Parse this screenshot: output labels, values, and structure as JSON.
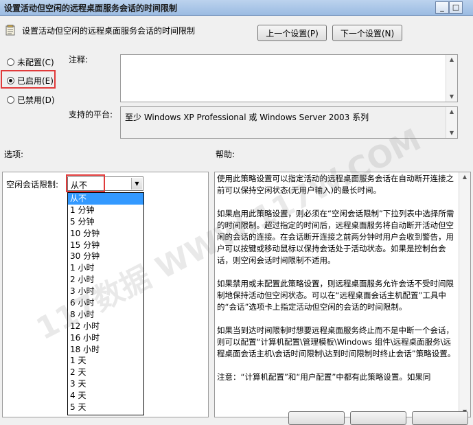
{
  "window": {
    "title": "设置活动但空闲的远程桌面服务会话的时间限制",
    "min_glyph": "_",
    "max_glyph": "□"
  },
  "header": {
    "title": "设置活动但空闲的远程桌面服务会话的时间限制",
    "prev_button": "上一个设置(P)",
    "next_button": "下一个设置(N)"
  },
  "state": {
    "not_configured": "未配置(C)",
    "enabled": "已启用(E)",
    "disabled": "已禁用(D)",
    "selected": "enabled"
  },
  "comment": {
    "label": "注释:",
    "value": ""
  },
  "platform": {
    "label": "支持的平台:",
    "value": "至少 Windows XP Professional 或 Windows Server 2003 系列"
  },
  "sections": {
    "options": "选项:",
    "help": "帮助:"
  },
  "options": {
    "idle_limit_label": "空闲会话限制:",
    "selected_value": "从不",
    "dropdown_items": [
      "从不",
      "1 分钟",
      "5 分钟",
      "10 分钟",
      "15 分钟",
      "30 分钟",
      "1 小时",
      "2 小时",
      "3 小时",
      "6 小时",
      "8 小时",
      "12 小时",
      "16 小时",
      "18 小时",
      "1 天",
      "2 天",
      "3 天",
      "4 天",
      "5 天"
    ]
  },
  "help": {
    "paragraphs": [
      "使用此策略设置可以指定活动的远程桌面服务会话在自动断开连接之前可以保持空闲状态(无用户输入)的最长时间。",
      "如果启用此策略设置，则必须在“空闲会话限制”下拉列表中选择所需的时间限制。超过指定的时间后，远程桌面服务将自动断开活动但空闲的会话的连接。在会话断开连接之前两分钟时用户会收到警告，用户可以按键或移动鼠标以保持会话处于活动状态。如果是控制台会话，则空闲会话时间限制不适用。",
      "如果禁用或未配置此策略设置，则远程桌面服务允许会话不受时间限制地保持活动但空闲状态。可以在“远程桌面会话主机配置”工具中的“会话”选项卡上指定活动但空闲的会话的时间限制。",
      "如果当到达时间限制时想要远程桌面服务终止而不是中断一个会话，则可以配置“计算机配置\\管理模板\\Windows 组件\\远程桌面服务\\远程桌面会话主机\\会话时间限制\\达到时间限制时终止会话”策略设置。",
      "注意：“计算机配置”和“用户配置”中都有此策略设置。如果同"
    ]
  },
  "watermark": {
    "text": "117数据 WWW.117W.COM"
  }
}
